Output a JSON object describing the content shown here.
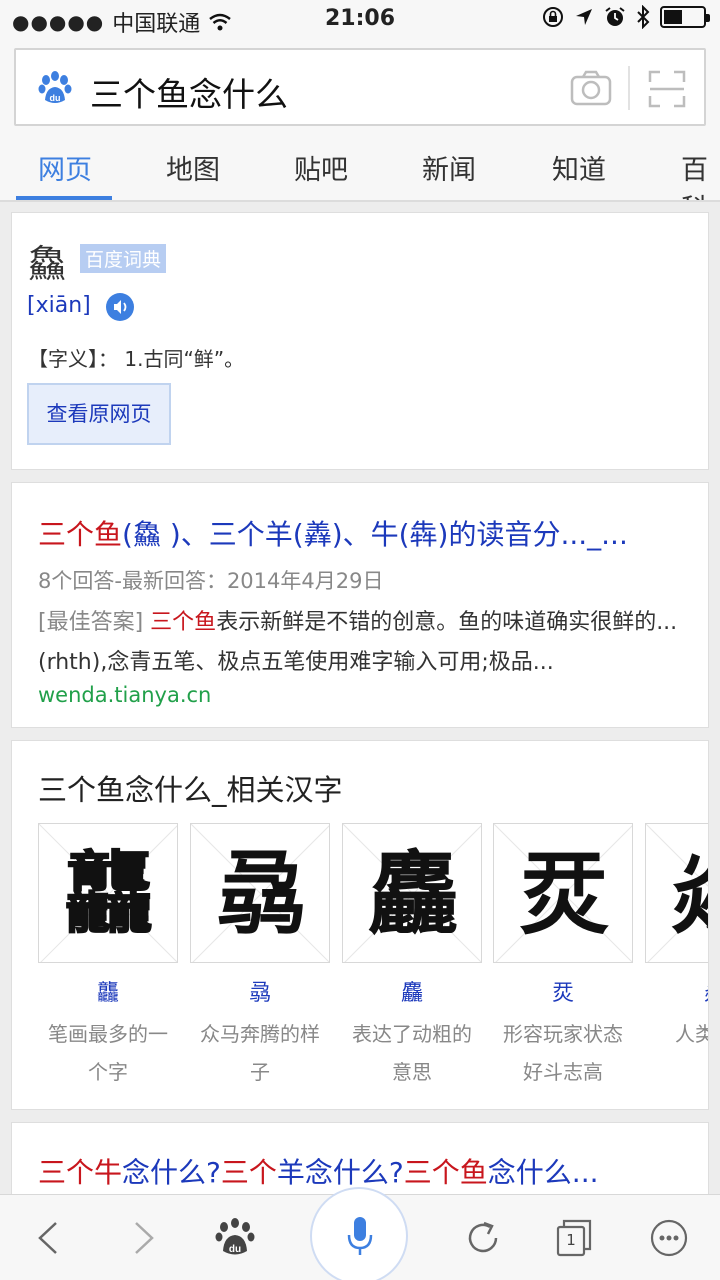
{
  "status": {
    "carrier": "中国联通",
    "time": "21:06"
  },
  "search": {
    "query": "三个鱼念什么"
  },
  "tabs": [
    "网页",
    "地图",
    "贴吧",
    "新闻",
    "知道",
    "百科"
  ],
  "dict": {
    "char": "鱻",
    "tag": "百度词典",
    "pinyin": "[xiān]",
    "meaning": "【字义】： 1.古同“鲜”。",
    "view_button": "查看原网页"
  },
  "result1": {
    "title_red": "三个鱼",
    "title_rest": "(鱻 )、三个羊(羴)、牛(犇)的读音分..._...",
    "meta": "8个回答-最新回答：2014年4月29日",
    "snippet_prefix": "[最佳答案] ",
    "snippet_red": "三个鱼",
    "snippet_rest": "表示新鲜是不错的创意。鱼的味道确实很鲜的...(rhth),念青五笔、极点五笔使用难字输入可用;极品...",
    "url": "wenda.tianya.cn"
  },
  "related": {
    "title": "三个鱼念什么_相关汉字",
    "items": [
      {
        "char": "龘",
        "desc": "笔画最多的一个字"
      },
      {
        "char": "骉",
        "desc": "众马奔腾的样子"
      },
      {
        "char": "麤",
        "desc": "表达了动粗的意思"
      },
      {
        "char": "烎",
        "desc": "形容玩家状态好斗志高"
      },
      {
        "char": "焱",
        "desc": "人类火之"
      }
    ]
  },
  "result2": {
    "parts": [
      {
        "text": "三个牛",
        "red": true
      },
      {
        "text": "念什么?",
        "red": false
      },
      {
        "text": "三个",
        "red": true
      },
      {
        "text": "羊念什么?",
        "red": false
      },
      {
        "text": "三个鱼",
        "red": true
      },
      {
        "text": "念什么...",
        "red": false
      }
    ]
  },
  "toolbar": {
    "tab_count": "1"
  },
  "colors": {
    "link": "#1c39bb",
    "accent": "#3d7fe0",
    "red": "#c8161d",
    "url": "#21a04a"
  },
  "icons": [
    "signal-dots-icon",
    "wifi-icon",
    "lock-rotation-icon",
    "location-icon",
    "alarm-icon",
    "bluetooth-icon",
    "battery-icon",
    "baidu-paw-icon",
    "camera-icon",
    "scan-icon",
    "speaker-icon",
    "back-icon",
    "forward-icon",
    "home-icon",
    "mic-icon",
    "refresh-icon",
    "tabs-icon",
    "more-icon"
  ]
}
